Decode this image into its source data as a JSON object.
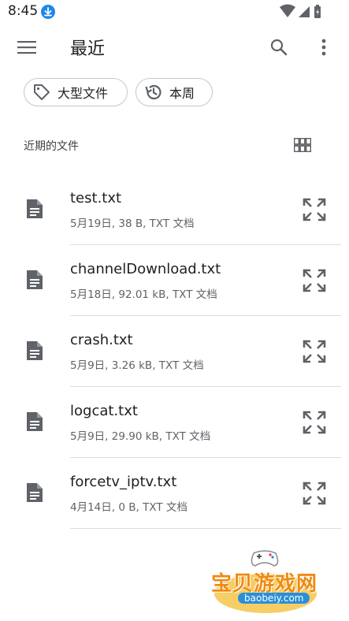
{
  "status_bar": {
    "time": "8:45"
  },
  "app_bar": {
    "title": "最近"
  },
  "chips": [
    {
      "label": "大型文件",
      "icon": "tag-icon"
    },
    {
      "label": "本周",
      "icon": "history-icon"
    }
  ],
  "section": {
    "header": "近期的文件"
  },
  "files": [
    {
      "name": "test.txt",
      "meta": "5月19日, 38 B, TXT 文档"
    },
    {
      "name": "channelDownload.txt",
      "meta": "5月18日, 92.01 kB, TXT 文档"
    },
    {
      "name": "crash.txt",
      "meta": "5月9日, 3.26 kB, TXT 文档"
    },
    {
      "name": "logcat.txt",
      "meta": "5月9日, 29.90 kB, TXT 文档"
    },
    {
      "name": "forcetv_iptv.txt",
      "meta": "4月14日, 0 B, TXT 文档"
    }
  ],
  "watermark": {
    "text": "宝贝游戏网",
    "url": "baobeiy.com"
  },
  "colors": {
    "text_primary": "#202124",
    "text_secondary": "#5f6368",
    "divider": "#dadce0",
    "download_badge": "#1e88e5"
  }
}
